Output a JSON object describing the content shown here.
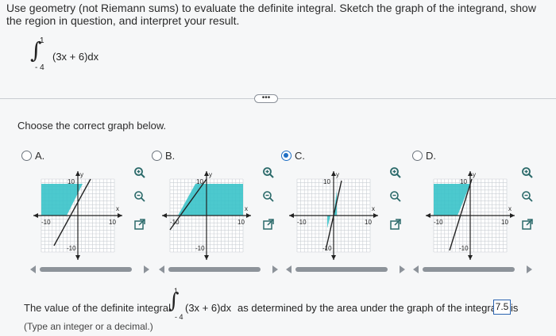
{
  "question": {
    "text": "Use geometry (not Riemann sums) to evaluate the definite integral. Sketch the graph of the integrand, show the region in question, and interpret your result.",
    "integral": {
      "upper": "1",
      "lower": "- 4",
      "integrand": "(3x + 6)dx"
    }
  },
  "more_button": "•••",
  "choose_label": "Choose the correct graph below.",
  "options": [
    {
      "letter": "A.",
      "selected": false
    },
    {
      "letter": "B.",
      "selected": false
    },
    {
      "letter": "C.",
      "selected": true
    },
    {
      "letter": "D.",
      "selected": false
    }
  ],
  "graph_labels": {
    "y": "y",
    "x": "x",
    "ten": "10",
    "neg_ten": "-10"
  },
  "icons": [
    "zoom-in-icon",
    "zoom-out-icon",
    "open-external-icon"
  ],
  "colors": {
    "fill": "#39c3c9",
    "grid": "#c9ced3",
    "axis": "#222222",
    "radio": "#1f6fc4"
  },
  "answer": {
    "prefix": "The value of the definite integral",
    "upper": "1",
    "lower": "- 4",
    "integrand": "(3x + 6)dx",
    "suffix": "as determined by the area under the graph of the integrand is",
    "value": "7.5",
    "hint": "(Type an integer or a decimal.)"
  }
}
